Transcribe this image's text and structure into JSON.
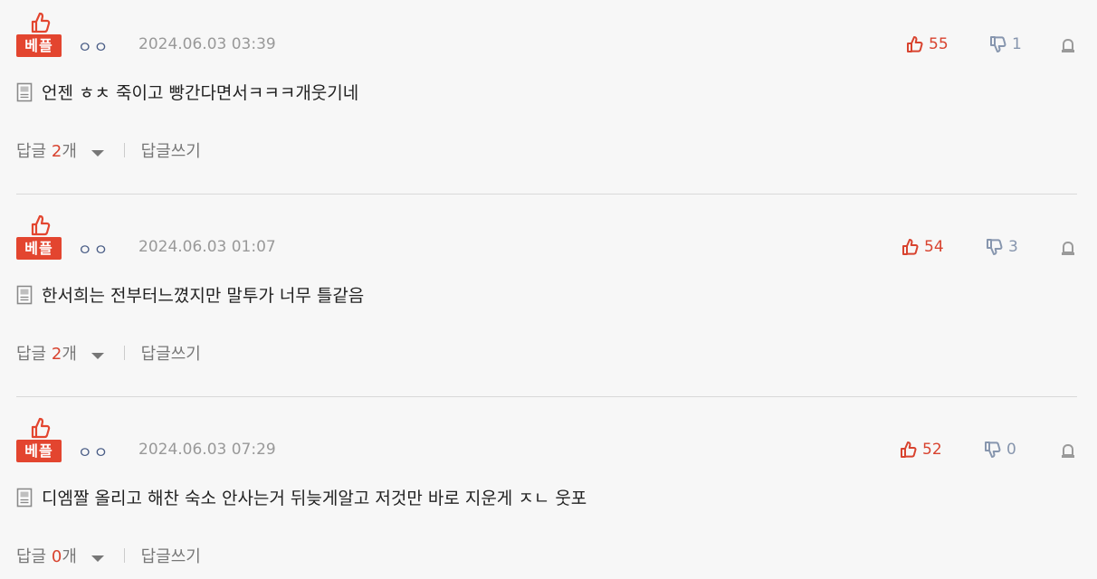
{
  "best_label": "베플",
  "icons": {
    "badge": "thumbs-up-icon",
    "like": "thumbs-up-icon",
    "dislike": "thumbs-down-icon",
    "report": "report-icon",
    "document": "document-icon",
    "expand": "caret-down-icon"
  },
  "colors": {
    "accent_red": "#e3452f",
    "like": "#d8432f",
    "dislike": "#8796ae"
  },
  "comments": [
    {
      "nickname": "ㅇㅇ",
      "date": "2024.06.03 03:39",
      "likes": "55",
      "dislikes": "1",
      "text": "언젠 ㅎㅊ 죽이고 빵간다면서ㅋㅋㅋ개웃기네",
      "reply_label": "답글",
      "reply_count": "2",
      "reply_unit": "개",
      "write_reply": "답글쓰기"
    },
    {
      "nickname": "ㅇㅇ",
      "date": "2024.06.03 01:07",
      "likes": "54",
      "dislikes": "3",
      "text": "한서희는 전부터느꼈지만 말투가 너무 틀같음",
      "reply_label": "답글",
      "reply_count": "2",
      "reply_unit": "개",
      "write_reply": "답글쓰기"
    },
    {
      "nickname": "ㅇㅇ",
      "date": "2024.06.03 07:29",
      "likes": "52",
      "dislikes": "0",
      "text": "디엠짤 올리고 해찬 숙소 안사는거 뒤늦게알고 저것만 바로 지운게 ㅈㄴ 웃포",
      "reply_label": "답글",
      "reply_count": "0",
      "reply_unit": "개",
      "write_reply": "답글쓰기"
    }
  ]
}
